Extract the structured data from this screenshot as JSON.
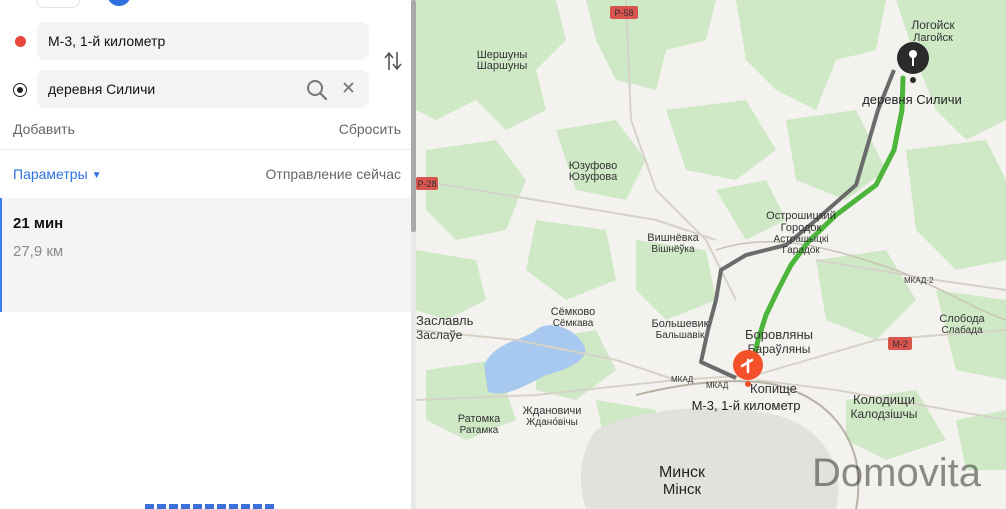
{
  "route_panel": {
    "from_value": "М-3, 1-й километр",
    "to_value": "деревня Силичи",
    "add_label": "Добавить",
    "reset_label": "Сбросить",
    "params_label": "Параметры",
    "departure_label": "Отправление сейчас",
    "route": {
      "duration": "21 мин",
      "distance": "27,9 км"
    }
  },
  "map": {
    "places": {
      "logoisk_ru": "Логойск",
      "logoisk_by": "Лагойск",
      "silichi": "деревня Силичи",
      "shershuny_ru": "Шершуны",
      "shershuny_by": "Шаршуны",
      "yuzufovo_ru": "Юзуфово",
      "yuzufovo_by": "Юзуфова",
      "ostroshitsky_ru1": "Острошицкий",
      "ostroshitsky_ru2": "Городок",
      "ostroshitsky_by1": "Астрашыцкі",
      "ostroshitsky_by2": "Гарадок",
      "vishnevka_ru": "Вишнёвка",
      "vishnevka_by": "Вішнёўка",
      "semkovo_ru": "Сёмково",
      "semkovo_by": "Сёмкава",
      "bolshevik_ru": "Большевик",
      "bolshevik_by": "Бальшавік",
      "borovlyany_ru": "Боровляны",
      "borovlyany_by": "Бараўляны",
      "zaslavl_ru": "Заславль",
      "zaslavl_by": "Заслаўе",
      "kopishche": "Копище",
      "start_label": "М-3, 1-й километр",
      "sloboda_ru": "Слобода",
      "sloboda_by": "Слабада",
      "kolodishchi_ru": "Колодищи",
      "kolodishchi_by": "Калодзішчы",
      "ratomka_ru": "Ратомка",
      "ratomka_by": "Ратамка",
      "zhdanovichi_ru": "Ждановичи",
      "zhdanovichi_by": "Жданóвічы",
      "minsk_ru": "Минск",
      "minsk_by": "Мінск"
    },
    "road_badges": {
      "r58": "Р-58",
      "r28": "Р-28",
      "m2": "М-2"
    },
    "road_labels": {
      "mkad": "МКАД",
      "mkad2": "МКАД-2"
    },
    "watermark": "Domovita",
    "colors": {
      "route_main": "#4cb63c",
      "route_alt": "#6b6b6b",
      "forest": "#cfe9c6",
      "water": "#a7c8ef",
      "start_marker": "#f4512a"
    }
  }
}
